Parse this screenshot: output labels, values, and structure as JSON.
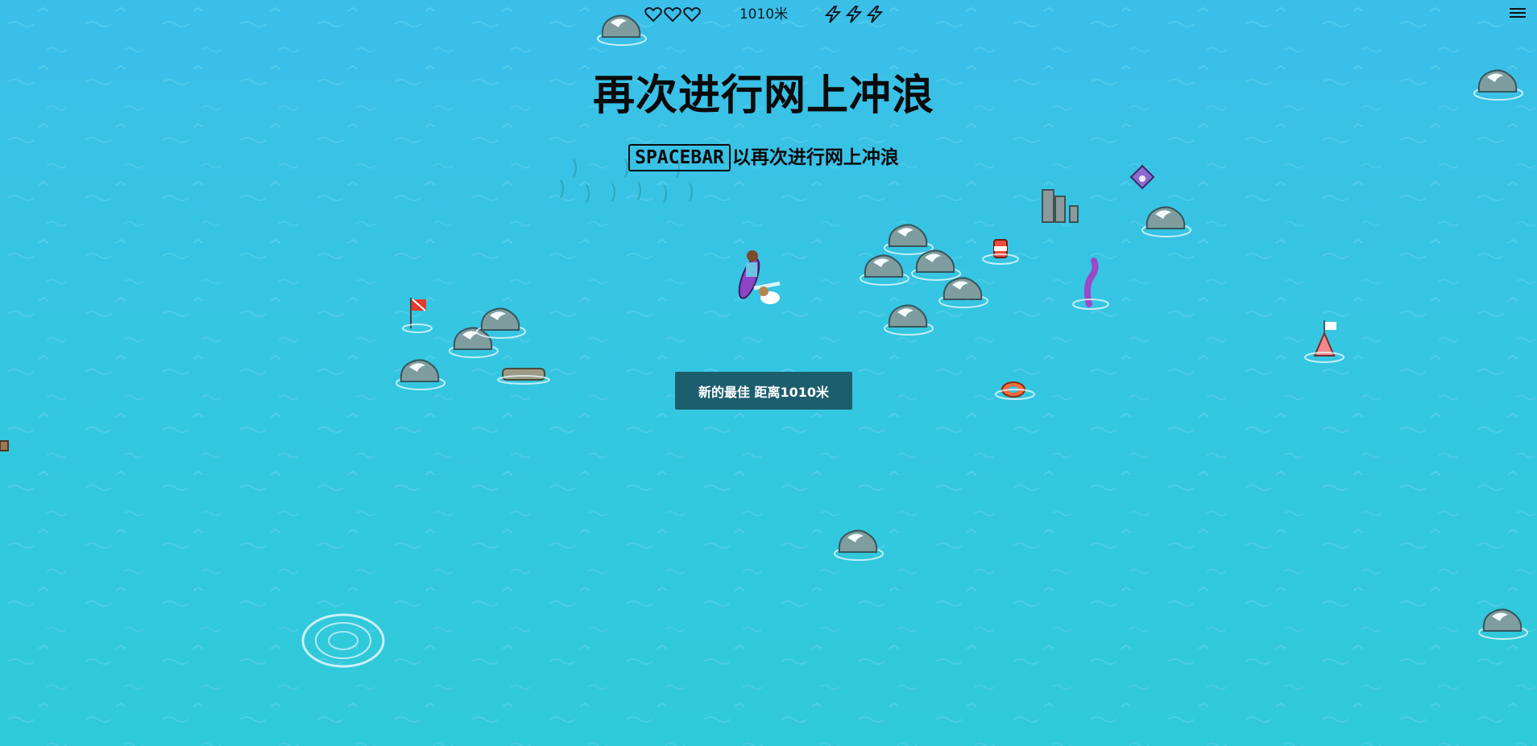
{
  "hud": {
    "lives": 3,
    "distance": "1010米",
    "boosts": 3
  },
  "title": "再次进行网上冲浪",
  "subtitle": {
    "key": "SPACEBAR",
    "text": "以再次进行网上冲浪"
  },
  "best_button": "新的最佳 距离1010米",
  "colors": {
    "ocean_top": "#3bbfe9",
    "ocean_bottom": "#2fcad8",
    "button_bg": "#1d5e6e",
    "rock": "#8fa8a8",
    "foam": "#f2fbff",
    "surfboard": "#8e44c9"
  },
  "icons": [
    "heart-icon",
    "lightning-icon",
    "menu-icon",
    "surfer-icon",
    "rock-icon",
    "flag-icon",
    "buoy-icon",
    "life-ring-icon",
    "tentacle-icon",
    "whirlpool-icon",
    "kelp-icon"
  ]
}
